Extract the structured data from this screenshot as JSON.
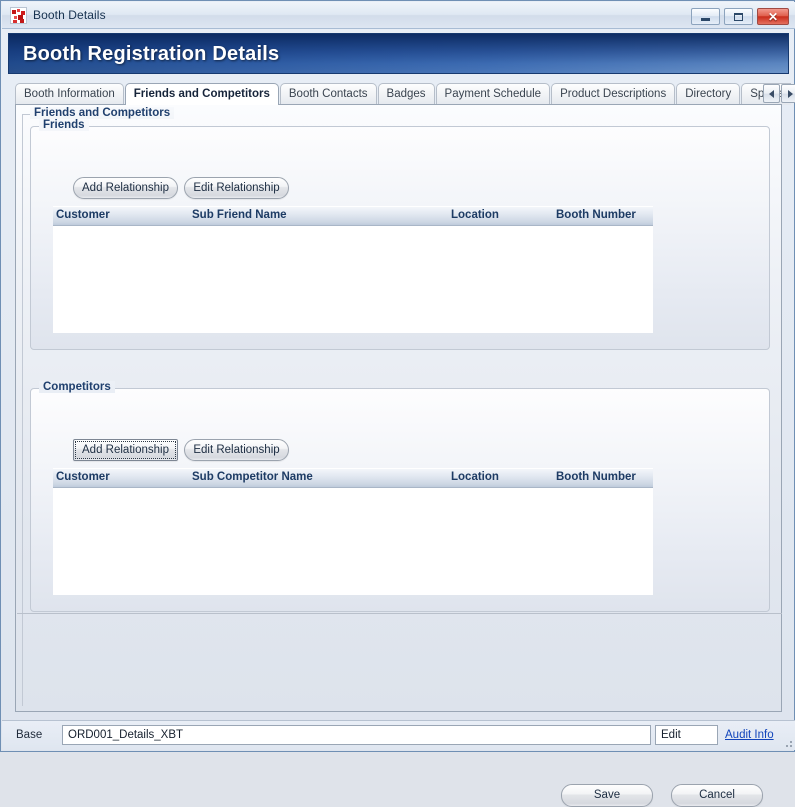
{
  "window": {
    "title": "Booth Details",
    "icon": "app-dots-icon",
    "controls": {
      "minimize": "–",
      "maximize": "□",
      "close": "✕"
    }
  },
  "header": {
    "title": "Booth Registration Details",
    "gradient_start": "#143a78",
    "gradient_end": "#6e95c8"
  },
  "tabs": [
    {
      "label": "Booth Information",
      "active": false
    },
    {
      "label": "Friends and Competitors",
      "active": true
    },
    {
      "label": "Booth Contacts",
      "active": false
    },
    {
      "label": "Badges",
      "active": false
    },
    {
      "label": "Payment Schedule",
      "active": false
    },
    {
      "label": "Product Descriptions",
      "active": false
    },
    {
      "label": "Directory",
      "active": false
    },
    {
      "label": "Space",
      "active": false
    }
  ],
  "tab_scroll": {
    "left": "scroll-left-icon",
    "right": "scroll-right-icon"
  },
  "content": {
    "outer_group_title": "Friends and Competitors",
    "friends": {
      "group_title": "Friends",
      "add_button": "Add Relationship",
      "edit_button": "Edit Relationship",
      "columns": [
        "Customer",
        "Sub Friend Name",
        "Location",
        "Booth Number"
      ],
      "rows": []
    },
    "competitors": {
      "group_title": "Competitors",
      "add_button": "Add Relationship",
      "edit_button": "Edit Relationship",
      "columns": [
        "Customer",
        "Sub Competitor Name",
        "Location",
        "Booth Number"
      ],
      "rows": []
    }
  },
  "actions": {
    "save": "Save",
    "cancel": "Cancel"
  },
  "statusbar": {
    "label": "Base",
    "value": "ORD001_Details_XBT",
    "edit": "Edit",
    "audit_link": "Audit Info",
    "link_color": "#1144bb"
  }
}
